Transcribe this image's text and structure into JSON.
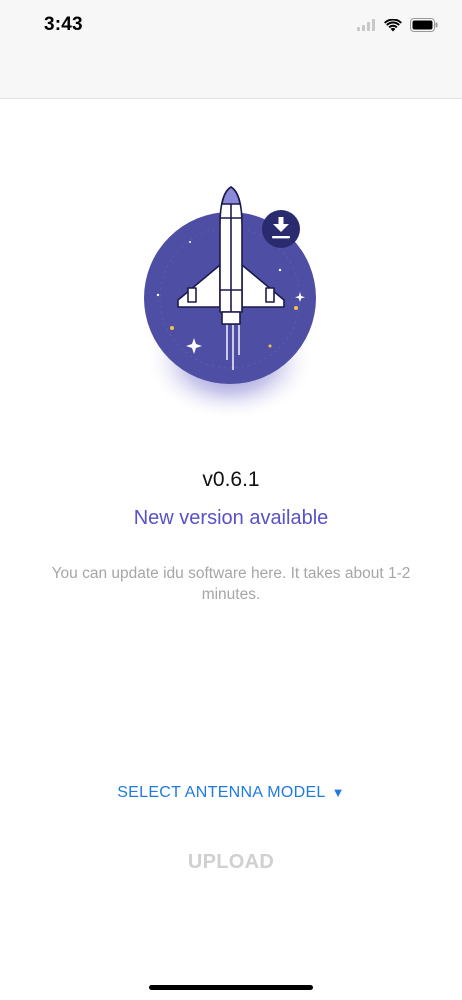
{
  "status_bar": {
    "time": "3:43",
    "icons": [
      "signal-icon",
      "wifi-icon",
      "battery-icon"
    ]
  },
  "hero": {
    "illustration": "rocket-launch-illustration",
    "badge_icon": "download-icon"
  },
  "update": {
    "version": "v0.6.1",
    "headline": "New version available",
    "description": "You can update idu software here. It takes about 1-2 minutes."
  },
  "actions": {
    "select_antenna_label": "SELECT ANTENNA MODEL",
    "select_antenna_caret": "▼",
    "upload_label": "UPLOAD"
  },
  "colors": {
    "accent": "#5a50c8",
    "link": "#1f7be0",
    "disabled": "#d0d0d0",
    "circle": "#4e4ea5"
  }
}
